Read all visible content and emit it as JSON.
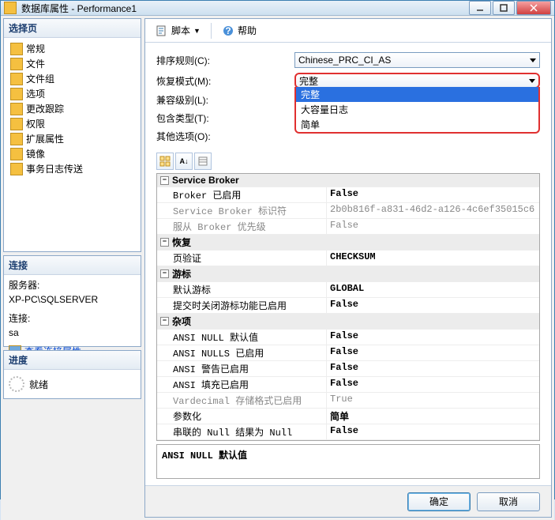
{
  "window": {
    "title": "数据库属性 - Performance1"
  },
  "leftPane": {
    "selectPages": {
      "header": "选择页",
      "items": [
        "常规",
        "文件",
        "文件组",
        "选项",
        "更改跟踪",
        "权限",
        "扩展属性",
        "镜像",
        "事务日志传送"
      ]
    },
    "connection": {
      "header": "连接",
      "serverLabel": "服务器:",
      "serverValue": "XP-PC\\SQLSERVER",
      "connLabel": "连接:",
      "connValue": "sa",
      "viewPropsLink": "查看连接属性"
    },
    "progress": {
      "header": "进度",
      "status": "就绪"
    }
  },
  "toolbar": {
    "script": "脚本",
    "help": "帮助"
  },
  "form": {
    "collationLabel": "排序规则(C):",
    "collationValue": "Chinese_PRC_CI_AS",
    "recoveryLabel": "恢复模式(M):",
    "recoveryValue": "完整",
    "recoveryOptions": [
      "完整",
      "大容量日志",
      "简单"
    ],
    "compatLabel": "兼容级别(L):",
    "compatValue": "",
    "containLabel": "包含类型(T):",
    "containValue": "",
    "otherLabel": "其他选项(O):"
  },
  "propGrid": {
    "categories": [
      {
        "name": "Service Broker",
        "rows": [
          {
            "n": "Broker 已启用",
            "v": "False",
            "bold": true
          },
          {
            "n": "Service Broker 标识符",
            "v": "2b0b816f-a831-46d2-a126-4c6ef35015c6",
            "readonly": true
          },
          {
            "n": "服从 Broker 优先级",
            "v": "False",
            "readonly": true
          }
        ]
      },
      {
        "name": "恢复",
        "rows": [
          {
            "n": "页验证",
            "v": "CHECKSUM",
            "bold": true
          }
        ]
      },
      {
        "name": "游标",
        "rows": [
          {
            "n": "默认游标",
            "v": "GLOBAL",
            "bold": true
          },
          {
            "n": "提交时关闭游标功能已启用",
            "v": "False",
            "bold": true
          }
        ]
      },
      {
        "name": "杂项",
        "rows": [
          {
            "n": "ANSI NULL 默认值",
            "v": "False",
            "bold": true
          },
          {
            "n": "ANSI NULLS 已启用",
            "v": "False",
            "bold": true
          },
          {
            "n": "ANSI 警告已启用",
            "v": "False",
            "bold": true
          },
          {
            "n": "ANSI 填充已启用",
            "v": "False",
            "bold": true
          },
          {
            "n": "Vardecimal 存储格式已启用",
            "v": "True",
            "readonly": true
          },
          {
            "n": "参数化",
            "v": "简单",
            "bold": true
          },
          {
            "n": "串联的 Null 结果为 Null",
            "v": "False",
            "bold": true
          }
        ]
      }
    ],
    "description": {
      "title": "ANSI NULL 默认值",
      "text": ""
    }
  },
  "buttons": {
    "ok": "确定",
    "cancel": "取消"
  }
}
